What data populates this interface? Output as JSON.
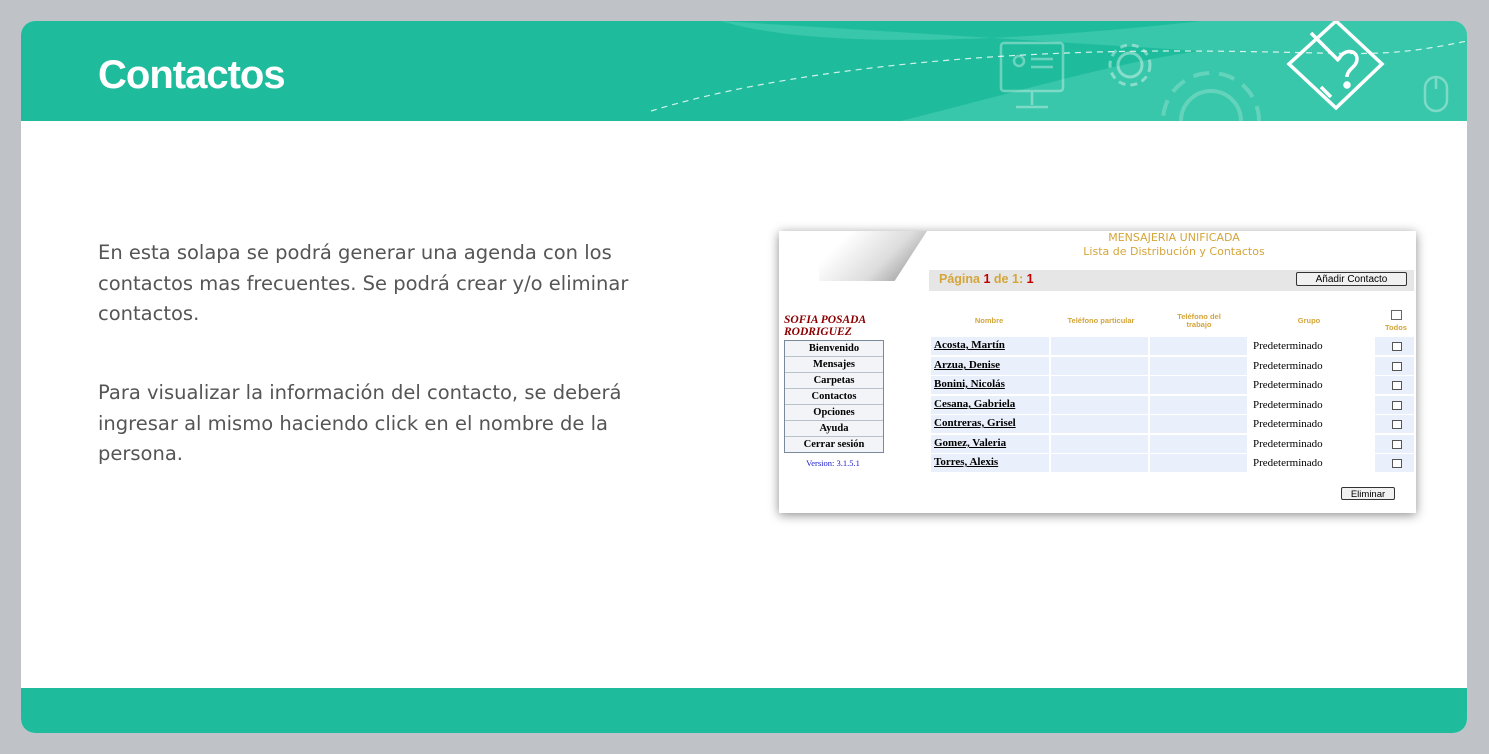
{
  "slide": {
    "title": "Contactos",
    "paragraphs": [
      "En esta solapa se podrá generar una agenda con los contactos mas frecuentes. Se podrá crear y/o eliminar contactos.",
      "Para visualizar la información del contacto, se deberá ingresar al mismo haciendo click en el nombre de la persona."
    ]
  },
  "colors": {
    "header": "#1ebc9c",
    "background": "#bfc3c7",
    "text": "#555555",
    "gold": "#d4a53a",
    "red": "#c00000"
  },
  "app": {
    "title": "MENSAJERIA UNIFICADA",
    "subtitle": "Lista de Distribución y Contactos",
    "pagination": {
      "label": "Página",
      "current": "1",
      "of": "de",
      "total": "1",
      "suffix": ":"
    },
    "add_button": "Añadir Contacto",
    "user": "SOFIA POSADA RODRIGUEZ",
    "menu": [
      "Bienvenido",
      "Mensajes",
      "Carpetas",
      "Contactos",
      "Opciones",
      "Ayuda",
      "Cerrar sesión"
    ],
    "version": "Version: 3.1.5.1",
    "columns": {
      "name": "Nombre",
      "phone_home": "Teléfono particular",
      "phone_work": "Teléfono del trabajo",
      "group": "Grupo",
      "all": "Todos"
    },
    "contacts": [
      {
        "name": "Acosta, Martín",
        "group": "Predeterminado"
      },
      {
        "name": "Arzua, Denise",
        "group": "Predeterminado"
      },
      {
        "name": "Bonini, Nicolás",
        "group": "Predeterminado"
      },
      {
        "name": "Cesana, Gabriela",
        "group": "Predeterminado"
      },
      {
        "name": "Contreras, Grisel",
        "group": "Predeterminado"
      },
      {
        "name": "Gomez, Valeria",
        "group": "Predeterminado"
      },
      {
        "name": "Torres, Alexis",
        "group": "Predeterminado"
      }
    ],
    "delete_button": "Eliminar"
  },
  "icons": [
    "monitor-presentation-icon",
    "gear-icon",
    "pencil-question-icon",
    "mouse-icon"
  ]
}
